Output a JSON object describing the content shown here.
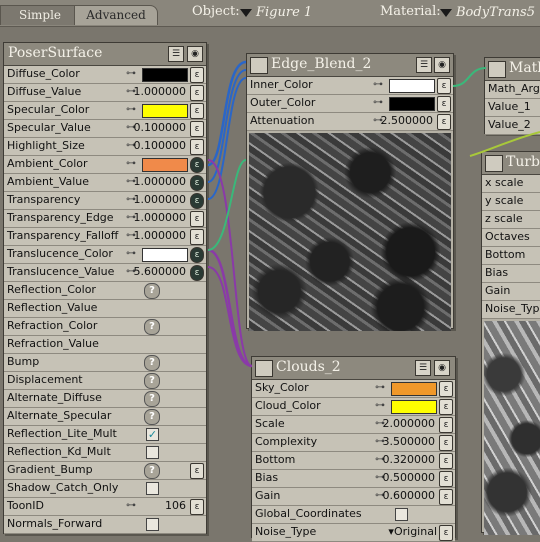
{
  "tabs": {
    "simple": "Simple",
    "advanced": "Advanced"
  },
  "header": {
    "object_label": "Object:",
    "object_value": "Figure 1",
    "material_label": "Material:",
    "material_value": "BodyTrans5"
  },
  "poser_surface": {
    "title": "PoserSurface",
    "rows": [
      {
        "label": "Diffuse_Color",
        "kind": "color",
        "color": "#000000",
        "link": true
      },
      {
        "label": "Diffuse_Value",
        "kind": "num",
        "value": "1.000000",
        "link": true
      },
      {
        "label": "Specular_Color",
        "kind": "color",
        "color": "#ffff00",
        "link": true
      },
      {
        "label": "Specular_Value",
        "kind": "num",
        "value": "0.100000",
        "link": true
      },
      {
        "label": "Highlight_Size",
        "kind": "num",
        "value": "0.100000",
        "link": true
      },
      {
        "label": "Ambient_Color",
        "kind": "color",
        "color": "#f08a4a",
        "link": true,
        "connected": true
      },
      {
        "label": "Ambient_Value",
        "kind": "num",
        "value": "1.000000",
        "link": true,
        "connected": true
      },
      {
        "label": "Transparency",
        "kind": "num",
        "value": "1.000000",
        "link": true,
        "connected": true
      },
      {
        "label": "Transparency_Edge",
        "kind": "num",
        "value": "1.000000",
        "link": true
      },
      {
        "label": "Transparency_Falloff",
        "kind": "num",
        "value": "1.000000",
        "link": true
      },
      {
        "label": "Translucence_Color",
        "kind": "color",
        "color": "#ffffff",
        "link": true,
        "connected": true
      },
      {
        "label": "Translucence_Value",
        "kind": "num",
        "value": "5.600000",
        "link": true,
        "connected": true
      },
      {
        "label": "Reflection_Color",
        "kind": "q"
      },
      {
        "label": "Reflection_Value",
        "kind": "none"
      },
      {
        "label": "Refraction_Color",
        "kind": "q"
      },
      {
        "label": "Refraction_Value",
        "kind": "none"
      },
      {
        "label": "Bump",
        "kind": "q"
      },
      {
        "label": "Displacement",
        "kind": "q"
      },
      {
        "label": "Alternate_Diffuse",
        "kind": "q"
      },
      {
        "label": "Alternate_Specular",
        "kind": "q"
      },
      {
        "label": "Reflection_Lite_Mult",
        "kind": "check",
        "checked": true
      },
      {
        "label": "Reflection_Kd_Mult",
        "kind": "check",
        "checked": false
      },
      {
        "label": "Gradient_Bump",
        "kind": "q",
        "knob": true
      },
      {
        "label": "Shadow_Catch_Only",
        "kind": "check",
        "checked": false
      },
      {
        "label": "ToonID",
        "kind": "int",
        "value": "106",
        "link": true
      },
      {
        "label": "Normals_Forward",
        "kind": "check",
        "checked": false
      }
    ]
  },
  "edge_blend": {
    "title": "Edge_Blend_2",
    "rows": [
      {
        "label": "Inner_Color",
        "kind": "color",
        "color": "#ffffff",
        "link": true
      },
      {
        "label": "Outer_Color",
        "kind": "color",
        "color": "#000000",
        "link": true
      },
      {
        "label": "Attenuation",
        "kind": "num",
        "value": "2.500000",
        "link": true
      }
    ]
  },
  "clouds": {
    "title": "Clouds_2",
    "rows": [
      {
        "label": "Sky_Color",
        "kind": "color",
        "color": "#f0982a",
        "link": true
      },
      {
        "label": "Cloud_Color",
        "kind": "color",
        "color": "#ffff00",
        "link": true
      },
      {
        "label": "Scale",
        "kind": "num",
        "value": "2.000000",
        "link": true
      },
      {
        "label": "Complexity",
        "kind": "num",
        "value": "3.500000",
        "link": true
      },
      {
        "label": "Bottom",
        "kind": "num",
        "value": "0.320000",
        "link": true
      },
      {
        "label": "Bias",
        "kind": "num",
        "value": "0.500000",
        "link": true
      },
      {
        "label": "Gain",
        "kind": "num",
        "value": "0.600000",
        "link": true
      },
      {
        "label": "Global_Coordinates",
        "kind": "check",
        "checked": false
      },
      {
        "label": "Noise_Type",
        "kind": "select",
        "value": "Original"
      }
    ]
  },
  "math": {
    "title": "Math",
    "rows": [
      "Math_Argu",
      "Value_1",
      "Value_2"
    ]
  },
  "turbulence": {
    "title": "Turbu",
    "rows": [
      "x scale",
      "y scale",
      "z scale",
      "Octaves",
      "Bottom",
      "Bias",
      "Gain",
      "Noise_Type"
    ]
  }
}
